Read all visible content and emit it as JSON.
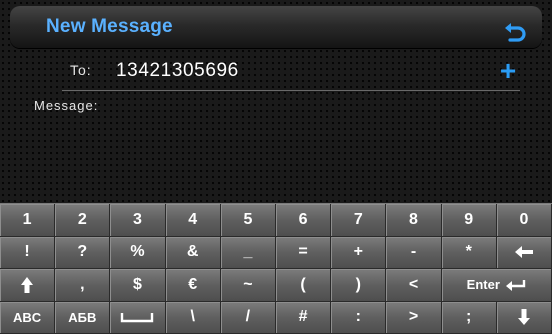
{
  "header": {
    "title": "New Message",
    "back_icon": "return-arrow-icon"
  },
  "recipient": {
    "label": "To:",
    "value": "13421305696",
    "add_icon": "plus-icon"
  },
  "message": {
    "label": "Message:",
    "value": ""
  },
  "colors": {
    "accent": "#5ab1ff",
    "plus": "#2a9cf5",
    "key_face": "#6a6a6a"
  },
  "keyboard": {
    "rows": [
      [
        "1",
        "2",
        "3",
        "4",
        "5",
        "6",
        "7",
        "8",
        "9",
        "0"
      ],
      [
        "!",
        "?",
        "%",
        "&",
        "_",
        "=",
        "+",
        "-",
        "*",
        "backspace"
      ],
      [
        "shift",
        ",",
        "$",
        "€",
        "~",
        "(",
        ")",
        "<",
        "Enter",
        "space"
      ],
      [
        "ABC",
        "АБВ",
        "space-bar",
        "\\",
        "/",
        "#",
        ":",
        ">",
        ";",
        "down"
      ]
    ],
    "icons": {
      "backspace": "backspace-arrow-icon",
      "shift": "shift-up-arrow-icon",
      "enter": "enter-return-icon",
      "space-bar": "space-bar-icon",
      "down": "hide-keyboard-down-arrow-icon"
    }
  }
}
